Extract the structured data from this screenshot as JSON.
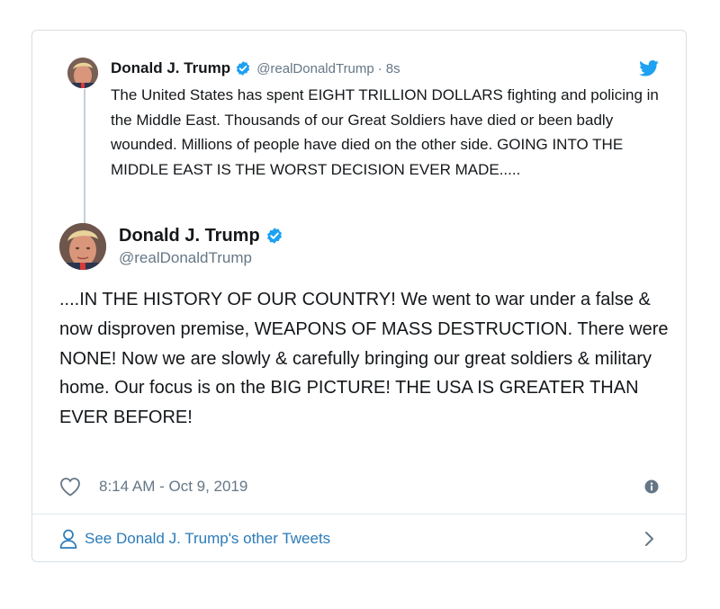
{
  "parent_tweet": {
    "author_name": "Donald J. Trump",
    "handle": "@realDonaldTrump",
    "separator": "·",
    "time": "8s",
    "text": "The United States has spent EIGHT TRILLION DOLLARS fighting and policing in the Middle East. Thousands of our Great Soldiers have died or been badly wounded. Millions of people have died on the other side. GOING INTO THE MIDDLE EAST IS THE WORST DECISION EVER MADE.....",
    "avatar_icon": "profile-avatar",
    "verified_icon": "verified-badge-icon",
    "brand_icon": "twitter-bird-icon"
  },
  "main_tweet": {
    "author_name": "Donald J. Trump",
    "handle": "@realDonaldTrump",
    "text": "....IN THE HISTORY OF OUR COUNTRY! We went to war under a false & now disproven premise, WEAPONS OF MASS DESTRUCTION. There were NONE! Now we are slowly & carefully bringing our great soldiers & military home. Our focus is on the BIG PICTURE! THE USA IS GREATER THAN EVER BEFORE!",
    "timestamp": "8:14 AM - Oct 9, 2019",
    "like_icon": "heart-icon",
    "info_icon": "info-icon"
  },
  "footer": {
    "label": "See Donald J. Trump's other Tweets",
    "person_icon": "person-icon",
    "chevron_icon": "chevron-right-icon"
  },
  "colors": {
    "text_primary": "#14171a",
    "text_secondary": "#657786",
    "link_blue": "#2b7bb9",
    "verified_blue": "#1da1f2",
    "border": "#d8dee3"
  }
}
